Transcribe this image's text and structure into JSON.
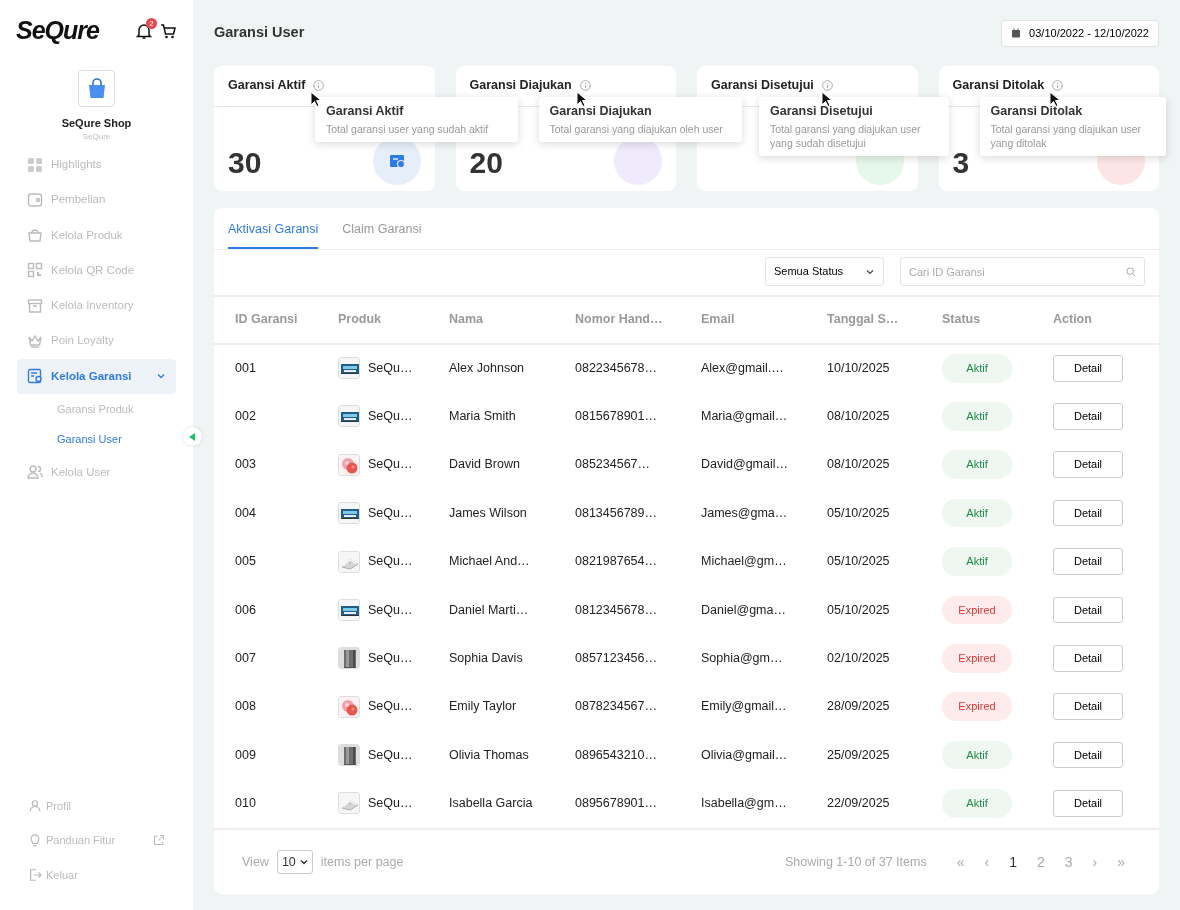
{
  "sidebar": {
    "logo": "SeQure",
    "notification_count": "2",
    "shop": {
      "name": "SeQure Shop",
      "subtitle": "SeQure"
    },
    "menu": [
      {
        "label": "Highlights",
        "selected": false
      },
      {
        "label": "Pembelian",
        "selected": false
      },
      {
        "label": "Kelola Produk",
        "selected": false
      },
      {
        "label": "Kelola QR Code",
        "selected": false
      },
      {
        "label": "Kelola Inventory",
        "selected": false
      },
      {
        "label": "Poin Loyalty",
        "selected": false
      },
      {
        "label": "Kelola Garansi",
        "selected": true,
        "expanded": true,
        "children": [
          {
            "label": "Garansi Produk",
            "selected": false
          },
          {
            "label": "Garansi User",
            "selected": true
          }
        ]
      },
      {
        "label": "Kelola User",
        "selected": false
      }
    ],
    "footer_menu": [
      {
        "label": "Profil",
        "external": false
      },
      {
        "label": "Panduan Fitur",
        "external": true
      },
      {
        "label": "Keluar",
        "external": false
      }
    ]
  },
  "page": {
    "title": "Garansi User",
    "date_range": "03/10/2022 - 12/10/2022"
  },
  "stats": [
    {
      "title": "Garansi Aktif",
      "value": "30",
      "color": "#e6eef9",
      "tooltip": {
        "title": "Garansi Aktif",
        "text": "Total garansi user yang sudah aktif"
      }
    },
    {
      "title": "Garansi Diajukan",
      "value": "20",
      "color": "#efeafc",
      "tooltip": {
        "title": "Garansi Diajukan",
        "text": "Total garansi yang diajukan oleh user"
      }
    },
    {
      "title": "Garansi Disetujui",
      "color": "#e5f7e9",
      "tooltip": {
        "title": "Garansi Disetujui",
        "text": "Total garansi yang diajukan user yang sudah disetujui"
      }
    },
    {
      "title": "Garansi Ditolak",
      "value": "3",
      "color": "#fde5e5",
      "tooltip": {
        "title": "Garansi Ditolak",
        "text": "Total garansi yang diajukan user yang ditolak"
      }
    }
  ],
  "tabs": [
    {
      "label": "Aktivasi Garansi",
      "selected": true
    },
    {
      "label": "Claim Garansi",
      "selected": false
    }
  ],
  "filter": {
    "status": "Semua Status",
    "search_placeholder": "Cari ID Garansi"
  },
  "table": {
    "columns": [
      "ID Garansi",
      "Produk",
      "Nama",
      "Nomor Hand…",
      "Email",
      "Tanggal S…",
      "Status",
      "Action"
    ],
    "rows": [
      {
        "id": "001",
        "product": "SeQu…",
        "name": "Alex Johnson",
        "phone": "0822345678…",
        "email": "Alex@gmail.…",
        "date": "10/10/2025",
        "status": "Aktif",
        "kind": "active",
        "action": "Detail"
      },
      {
        "id": "002",
        "product": "SeQu…",
        "name": "Maria Smith",
        "phone": "0815678901…",
        "email": "Maria@gmail…",
        "date": "08/10/2025",
        "status": "Aktif",
        "kind": "active",
        "action": "Detail"
      },
      {
        "id": "003",
        "product": "SeQu…",
        "name": "David Brown",
        "phone": "085234567…",
        "email": "David@gmail…",
        "date": "08/10/2025",
        "status": "Aktif",
        "kind": "active",
        "action": "Detail"
      },
      {
        "id": "004",
        "product": "SeQu…",
        "name": "James Wilson",
        "phone": "0813456789…",
        "email": "James@gma…",
        "date": "05/10/2025",
        "status": "Aktif",
        "kind": "active",
        "action": "Detail"
      },
      {
        "id": "005",
        "product": "SeQu…",
        "name": "Michael And…",
        "phone": "0821987654…",
        "email": "Michael@gm…",
        "date": "05/10/2025",
        "status": "Aktif",
        "kind": "active",
        "action": "Detail"
      },
      {
        "id": "006",
        "product": "SeQu…",
        "name": "Daniel Marti…",
        "phone": "0812345678…",
        "email": "Daniel@gma…",
        "date": "05/10/2025",
        "status": "Expired",
        "kind": "expired",
        "action": "Detail"
      },
      {
        "id": "007",
        "product": "SeQu…",
        "name": "Sophia Davis",
        "phone": "0857123456…",
        "email": "Sophia@gm…",
        "date": "02/10/2025",
        "status": "Expired",
        "kind": "expired",
        "action": "Detail"
      },
      {
        "id": "008",
        "product": "SeQu…",
        "name": "Emily Taylor",
        "phone": "0878234567…",
        "email": "Emily@gmail…",
        "date": "28/09/2025",
        "status": "Expired",
        "kind": "expired",
        "action": "Detail"
      },
      {
        "id": "009",
        "product": "SeQu…",
        "name": "Olivia Thomas",
        "phone": "0896543210…",
        "email": "Olivia@gmail…",
        "date": "25/09/2025",
        "status": "Aktif",
        "kind": "active",
        "action": "Detail"
      },
      {
        "id": "010",
        "product": "SeQu…",
        "name": "Isabella Garcia",
        "phone": "0895678901…",
        "email": "Isabella@gm…",
        "date": "22/09/2025",
        "status": "Aktif",
        "kind": "active",
        "action": "Detail"
      }
    ]
  },
  "pagination": {
    "view_label": "View",
    "page_size": "10",
    "per_page_label": "items per page",
    "summary": "Showing 1-10 of 37 Items",
    "first": "«",
    "prev": "‹",
    "pages": [
      {
        "label": "1",
        "selected": true
      },
      {
        "label": "2",
        "selected": false
      },
      {
        "label": "3",
        "selected": false
      }
    ],
    "next": "›",
    "last": "»"
  }
}
